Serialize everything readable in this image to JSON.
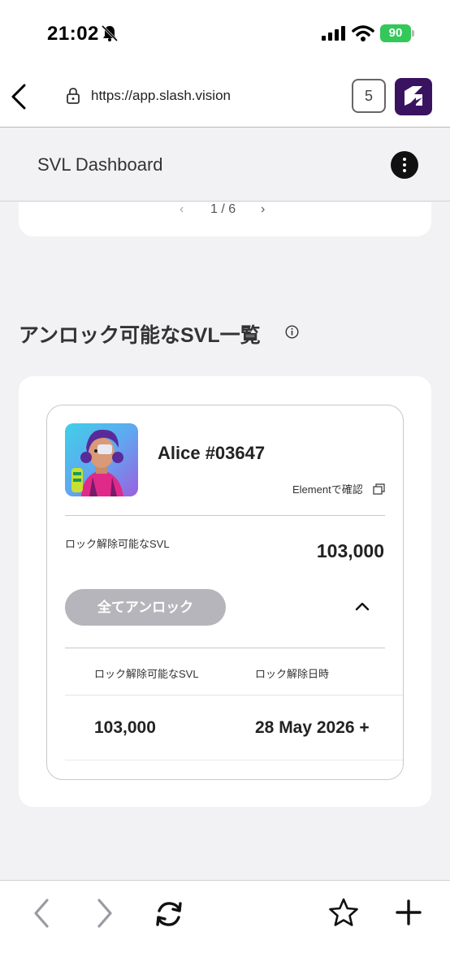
{
  "status_bar": {
    "time": "21:02",
    "battery": "90"
  },
  "browser": {
    "url": "https://app.slash.vision",
    "tab_count": "5"
  },
  "page": {
    "title": "SVL Dashboard"
  },
  "pager": {
    "prev": "‹",
    "text": "1 / 6",
    "next": "›"
  },
  "section": {
    "heading": "アンロック可能なSVL一覧"
  },
  "nft": {
    "name": "Alice #03647",
    "element_link": "Elementで確認",
    "unlockable_label": "ロック解除可能なSVL",
    "unlockable_value": "103,000",
    "unlock_all_button": "全てアンロック",
    "table": {
      "headers": [
        "ロック解除可能なSVL",
        "ロック解除日時"
      ],
      "rows": [
        [
          "103,000",
          "28 May 2026 +"
        ]
      ]
    }
  },
  "colors": {
    "brand": "#3a1360",
    "battery": "#34c759",
    "button_disabled": "#b5b5bb"
  }
}
